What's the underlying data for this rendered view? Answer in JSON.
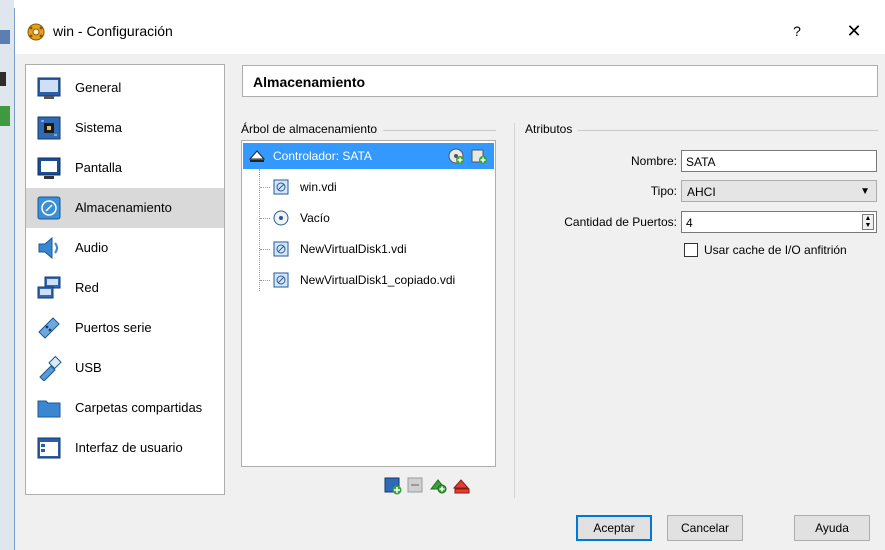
{
  "window": {
    "title": "win - Configuración",
    "help_label": "?",
    "close_label": "✕"
  },
  "sidebar": {
    "items": [
      {
        "label": "General",
        "icon": "general-icon"
      },
      {
        "label": "Sistema",
        "icon": "system-icon"
      },
      {
        "label": "Pantalla",
        "icon": "display-icon"
      },
      {
        "label": "Almacenamiento",
        "icon": "storage-icon",
        "active": true
      },
      {
        "label": "Audio",
        "icon": "audio-icon"
      },
      {
        "label": "Red",
        "icon": "network-icon"
      },
      {
        "label": "Puertos serie",
        "icon": "serial-ports-icon"
      },
      {
        "label": "USB",
        "icon": "usb-icon"
      },
      {
        "label": "Carpetas compartidas",
        "icon": "shared-folders-icon"
      },
      {
        "label": "Interfaz de usuario",
        "icon": "user-interface-icon"
      }
    ]
  },
  "main": {
    "section_title": "Almacenamiento",
    "tree_title": "Árbol de almacenamiento",
    "tree": {
      "controller": "Controlador: SATA",
      "items": [
        {
          "label": "win.vdi",
          "icon": "hard-disk-icon"
        },
        {
          "label": "Vacío",
          "icon": "optical-disc-icon"
        },
        {
          "label": "NewVirtualDisk1.vdi",
          "icon": "hard-disk-icon"
        },
        {
          "label": "NewVirtualDisk1_copiado.vdi",
          "icon": "hard-disk-icon"
        }
      ]
    },
    "attributes": {
      "title": "Atributos",
      "name_label": "Nombre:",
      "name_value": "SATA",
      "type_label": "Tipo:",
      "type_value": "AHCI",
      "ports_label": "Cantidad de Puertos:",
      "ports_value": "4",
      "cache_label": "Usar cache de I/O anfitrión",
      "cache_checked": false
    }
  },
  "buttons": {
    "accept": "Aceptar",
    "cancel": "Cancelar",
    "help": "Ayuda"
  },
  "colors": {
    "selection": "#3399ff",
    "active_sidebar": "#d9d9d9",
    "window_bg": "#f0f0f0"
  }
}
